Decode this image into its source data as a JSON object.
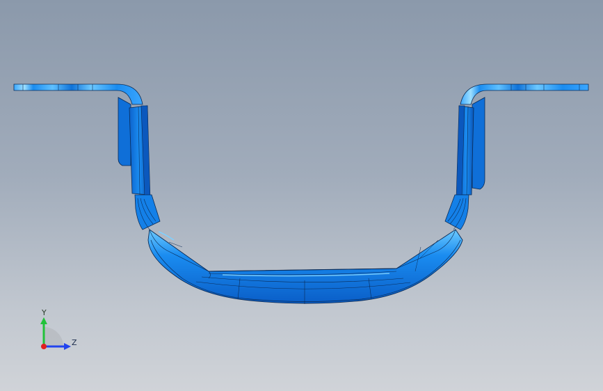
{
  "view": {
    "background_top": "#8b99ab",
    "background_bottom": "#d0d3d8",
    "part_color": "#1a8cf0",
    "part_shade": "#0b5fc9",
    "part_highlight": "#7fd0ff",
    "edge_color": "#0a2a55"
  },
  "triad": {
    "y_label": "Y",
    "z_label": "Z",
    "y_color": "#22c23a",
    "z_color": "#2244ee",
    "x_color": "#e02020"
  }
}
